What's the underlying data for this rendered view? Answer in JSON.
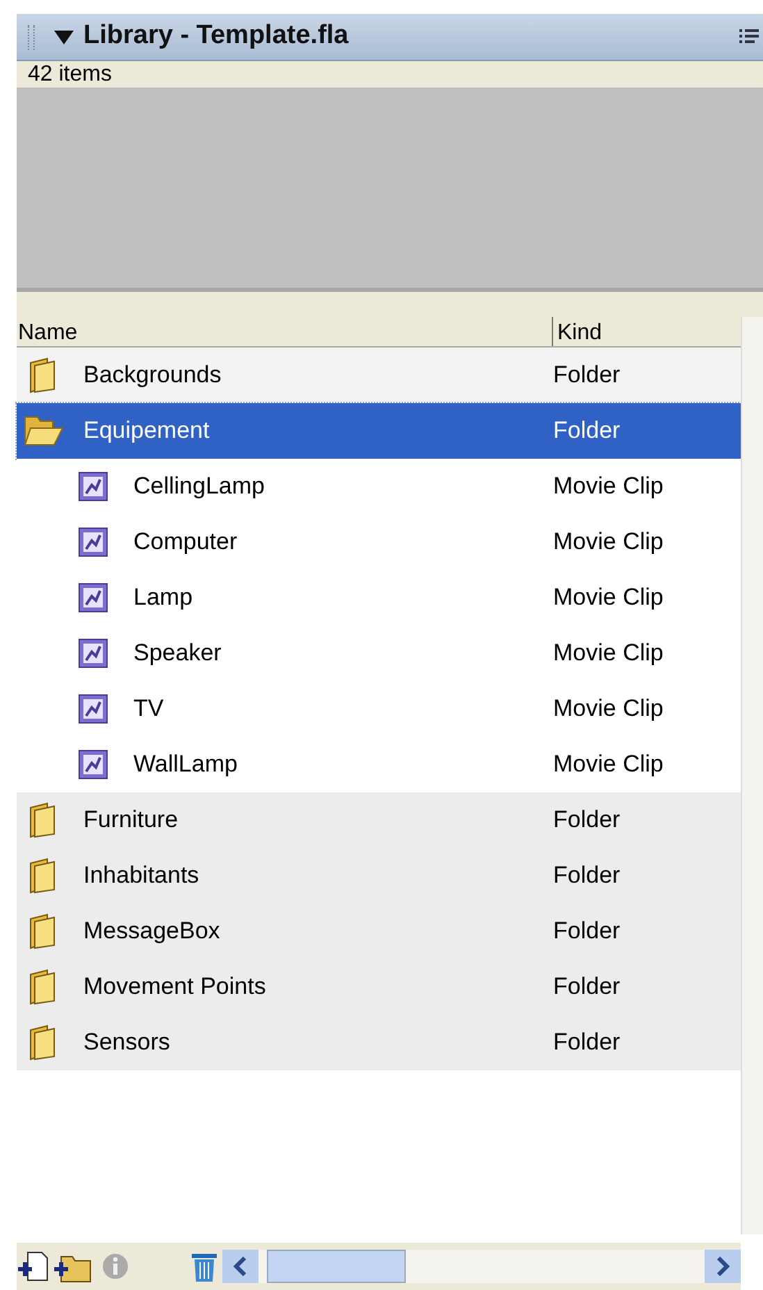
{
  "panel": {
    "title": "Library - Template.fla",
    "expanded": true
  },
  "item_count": "42 items",
  "columns": [
    "Name",
    "Kind"
  ],
  "items": [
    {
      "name": "Backgrounds",
      "type": "Folder",
      "kind": "folder",
      "expanded": false,
      "selected": false
    },
    {
      "name": "Equipement",
      "type": "Folder",
      "kind": "folder",
      "expanded": true,
      "selected": true,
      "children": [
        {
          "name": "CellingLamp",
          "type": "Movie Clip",
          "kind": "movie-clip",
          "selected": false
        },
        {
          "name": "Computer",
          "type": "Movie Clip",
          "kind": "movie-clip",
          "selected": false
        },
        {
          "name": "Lamp",
          "type": "Movie Clip",
          "kind": "movie-clip",
          "selected": false
        },
        {
          "name": "Speaker",
          "type": "Movie Clip",
          "kind": "movie-clip",
          "selected": false
        },
        {
          "name": "TV",
          "type": "Movie Clip",
          "kind": "movie-clip",
          "selected": false
        },
        {
          "name": "WallLamp",
          "type": "Movie Clip",
          "kind": "movie-clip",
          "selected": false
        }
      ]
    },
    {
      "name": "Furniture",
      "type": "Folder",
      "kind": "folder",
      "expanded": false,
      "selected": false
    },
    {
      "name": "Inhabitants",
      "type": "Folder",
      "kind": "folder",
      "expanded": false,
      "selected": false
    },
    {
      "name": "MessageBox",
      "type": "Folder",
      "kind": "folder",
      "expanded": false,
      "selected": false
    },
    {
      "name": "Movement Points",
      "type": "Folder",
      "kind": "folder",
      "expanded": false,
      "selected": false
    },
    {
      "name": "Sensors",
      "type": "Folder",
      "kind": "folder",
      "expanded": false,
      "selected": false
    }
  ]
}
